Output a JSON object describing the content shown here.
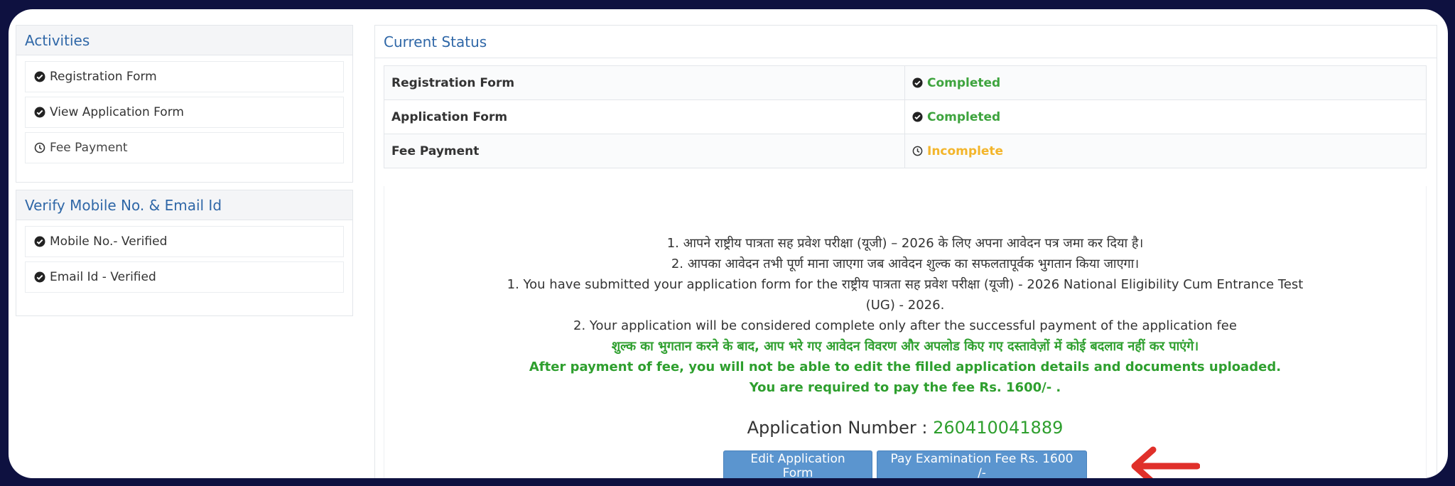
{
  "activities": {
    "title": "Activities",
    "items": [
      {
        "label": "Registration Form",
        "status": "completed"
      },
      {
        "label": "View Application Form",
        "status": "completed"
      },
      {
        "label": "Fee Payment",
        "status": "pending"
      }
    ]
  },
  "verify": {
    "title": "Verify Mobile No. & Email Id",
    "items": [
      {
        "label": "Mobile No.- Verified",
        "status": "completed"
      },
      {
        "label": "Email Id - Verified",
        "status": "completed"
      }
    ]
  },
  "current_status": {
    "title": "Current Status",
    "rows": [
      {
        "label": "Registration Form",
        "status": "Completed",
        "state": "completed"
      },
      {
        "label": "Application Form",
        "status": "Completed",
        "state": "completed"
      },
      {
        "label": "Fee Payment",
        "status": "Incomplete",
        "state": "pending"
      }
    ]
  },
  "notice": {
    "hi_line1": "1. आपने राष्ट्रीय पात्रता सह प्रवेश परीक्षा (यूजी) – 2026 के लिए अपना आवेदन पत्र जमा कर दिया है।",
    "hi_line2": "2. आपका आवेदन तभी पूर्ण माना जाएगा जब आवेदन शुल्क का सफलतापूर्वक भुगतान किया जाएगा।",
    "en_line1": "1. You have submitted your application form for the राष्ट्रीय पात्रता सह प्रवेश परीक्षा (यूजी) - 2026 National Eligibility Cum Entrance Test (UG) - 2026.",
    "en_line2": "2. Your application will be considered complete only after the successful payment of the application fee",
    "hi_warning": "शुल्क का भुगतान करने के बाद, आप भरे गए आवेदन विवरण और अपलोड किए गए दस्तावेज़ों में कोई बदलाव नहीं कर पाएंगे।",
    "en_warning": "After payment of fee, you will not be able to edit the filled application details and documents uploaded.",
    "fee_line": "You are required to pay the fee Rs. 1600/- ."
  },
  "application": {
    "label": "Application Number :",
    "number": "260410041889"
  },
  "buttons": {
    "edit": "Edit Application Form",
    "pay": "Pay Examination Fee Rs. 1600 /-"
  },
  "colors": {
    "accent": "#2f67a7",
    "completed": "#3ea43e",
    "pending": "#f3b52b",
    "button": "#5b95cf",
    "arrow": "#e0302a"
  }
}
